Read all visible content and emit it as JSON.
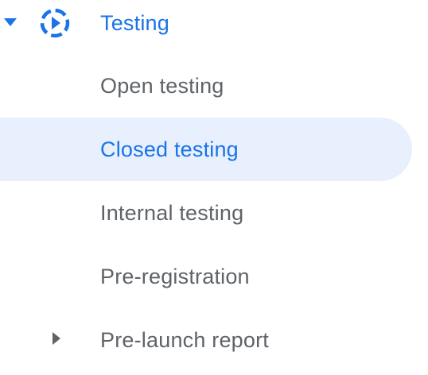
{
  "nav": {
    "parent": {
      "label": "Testing",
      "icon": "testing-icon",
      "expanded": true
    },
    "items": [
      {
        "label": "Open testing",
        "selected": false
      },
      {
        "label": "Closed testing",
        "selected": true
      },
      {
        "label": "Internal testing",
        "selected": false
      },
      {
        "label": "Pre-registration",
        "selected": false
      },
      {
        "label": "Pre-launch report",
        "selected": false,
        "expandable": true,
        "expanded": false
      }
    ]
  },
  "colors": {
    "accent": "#1a73e8",
    "selected_bg": "#e8f0fe",
    "text": "#5f6368"
  }
}
